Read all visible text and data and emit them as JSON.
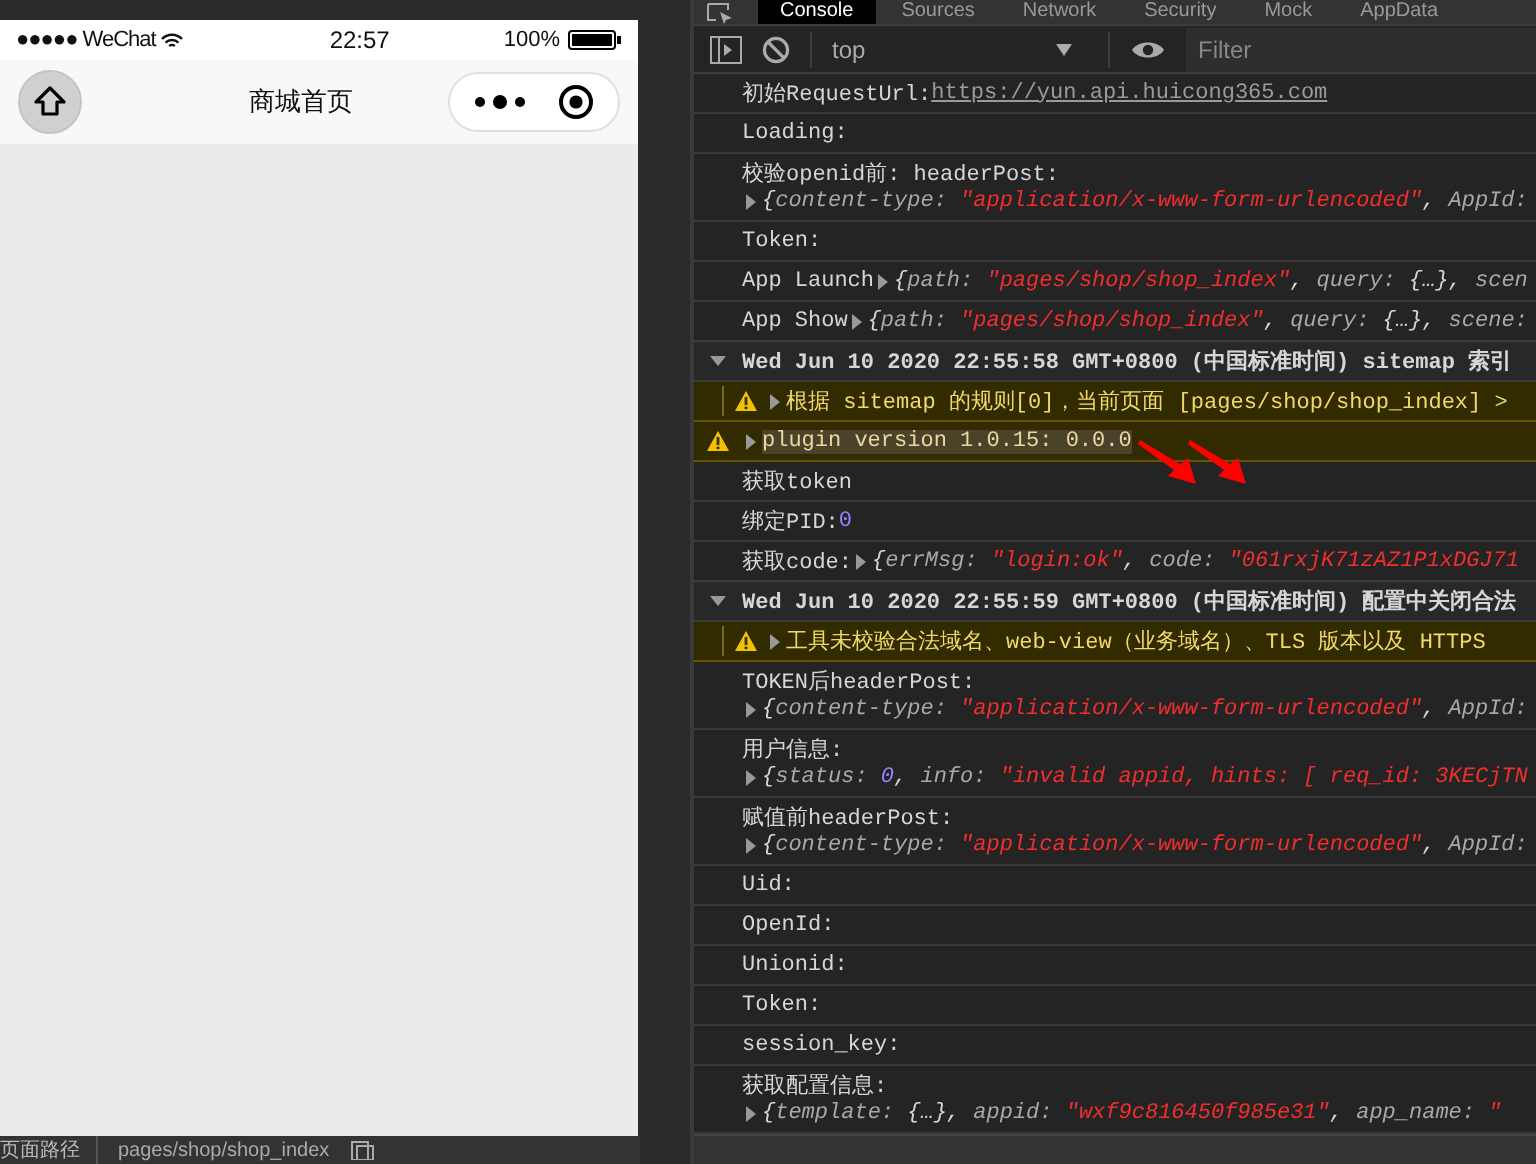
{
  "simulator": {
    "status_bar": {
      "carrier": "●●●●● WeChat",
      "time": "22:57",
      "battery": "100%"
    },
    "nav_bar": {
      "title": "商城首页"
    }
  },
  "sim_footer": {
    "label": "页面路径",
    "path": "pages/shop/shop_index"
  },
  "devtools": {
    "tabs": [
      {
        "label": "Console",
        "selected": true
      },
      {
        "label": "Sources",
        "selected": false
      },
      {
        "label": "Network",
        "selected": false
      },
      {
        "label": "Security",
        "selected": false
      },
      {
        "label": "Mock",
        "selected": false
      },
      {
        "label": "AppData",
        "selected": false
      }
    ],
    "toolbar": {
      "context": "top",
      "filter": {
        "placeholder": "Filter"
      }
    },
    "rows": [
      {
        "kind": "log",
        "text": "初始RequestUrl: ",
        "link": "https://yun.api.huicong365.com"
      },
      {
        "kind": "log",
        "text": "Loading:"
      },
      {
        "kind": "log",
        "text": "校验openid前: headerPost:",
        "object": [
          {
            "kind": "punct",
            "text": "{"
          },
          {
            "kind": "key",
            "text": "content-type: "
          },
          {
            "kind": "string",
            "text": "\"application/x-www-form-urlencoded\""
          },
          {
            "kind": "punct",
            "text": ", "
          },
          {
            "kind": "key",
            "text": "AppId:"
          }
        ]
      },
      {
        "kind": "log",
        "text": "Token:"
      },
      {
        "kind": "inline",
        "text": "App Launch ",
        "object": [
          {
            "kind": "punct",
            "text": "{"
          },
          {
            "kind": "key",
            "text": "path: "
          },
          {
            "kind": "string",
            "text": "\"pages/shop/shop_index\""
          },
          {
            "kind": "punct",
            "text": ", "
          },
          {
            "kind": "key",
            "text": "query: "
          },
          {
            "kind": "punct",
            "text": "{…}, "
          },
          {
            "kind": "key",
            "text": "scen"
          }
        ]
      },
      {
        "kind": "inline",
        "text": "App Show ",
        "object": [
          {
            "kind": "punct",
            "text": "{"
          },
          {
            "kind": "key",
            "text": "path: "
          },
          {
            "kind": "string",
            "text": "\"pages/shop/shop_index\""
          },
          {
            "kind": "punct",
            "text": ", "
          },
          {
            "kind": "key",
            "text": "query: "
          },
          {
            "kind": "punct",
            "text": "{…}, "
          },
          {
            "kind": "key",
            "text": "scene:"
          }
        ]
      },
      {
        "kind": "group",
        "text": "Wed Jun 10 2020 22:55:58 GMT+0800 (中国标准时间) sitemap 索引",
        "expanded": true
      },
      {
        "kind": "nested_warning",
        "text": "根据 sitemap 的规则[0]，当前页面 [pages/shop/shop_index] >"
      },
      {
        "kind": "warning",
        "text": "plugin version 1.0.15: 0.0.0",
        "highlighted": true
      },
      {
        "kind": "log",
        "text": "获取token"
      },
      {
        "kind": "log",
        "text": "绑定PID: ",
        "number": "0"
      },
      {
        "kind": "inline",
        "text": "获取code: ",
        "object": [
          {
            "kind": "punct",
            "text": "{"
          },
          {
            "kind": "key",
            "text": "errMsg: "
          },
          {
            "kind": "string",
            "text": "\"login:ok\""
          },
          {
            "kind": "punct",
            "text": ", "
          },
          {
            "kind": "key",
            "text": "code: "
          },
          {
            "kind": "string",
            "text": "\"061rxjK71zAZ1P1xDGJ71"
          }
        ]
      },
      {
        "kind": "group",
        "text": "Wed Jun 10 2020 22:55:59 GMT+0800 (中国标准时间) 配置中关闭合法",
        "expanded": true
      },
      {
        "kind": "nested_warning",
        "text": "工具未校验合法域名、web-view（业务域名）、TLS 版本以及 HTTPS"
      },
      {
        "kind": "log",
        "text": "TOKEN后headerPost:",
        "object": [
          {
            "kind": "punct",
            "text": "{"
          },
          {
            "kind": "key",
            "text": "content-type: "
          },
          {
            "kind": "string",
            "text": "\"application/x-www-form-urlencoded\""
          },
          {
            "kind": "punct",
            "text": ", "
          },
          {
            "kind": "key",
            "text": "AppId:"
          }
        ]
      },
      {
        "kind": "log",
        "text": "用户信息:",
        "object": [
          {
            "kind": "punct",
            "text": "{"
          },
          {
            "kind": "key",
            "text": "status: "
          },
          {
            "kind": "number",
            "text": "0"
          },
          {
            "kind": "punct",
            "text": ", "
          },
          {
            "kind": "key",
            "text": "info: "
          },
          {
            "kind": "string",
            "text": "\"invalid appid, hints: [ req_id: 3KECjTN"
          }
        ]
      },
      {
        "kind": "log",
        "text": "赋值前headerPost:",
        "object": [
          {
            "kind": "punct",
            "text": "{"
          },
          {
            "kind": "key",
            "text": "content-type: "
          },
          {
            "kind": "string",
            "text": "\"application/x-www-form-urlencoded\""
          },
          {
            "kind": "punct",
            "text": ", "
          },
          {
            "kind": "key",
            "text": "AppId:"
          }
        ]
      },
      {
        "kind": "log",
        "text": "Uid:"
      },
      {
        "kind": "log",
        "text": "OpenId:"
      },
      {
        "kind": "log",
        "text": "Unionid:"
      },
      {
        "kind": "log",
        "text": "Token:"
      },
      {
        "kind": "log",
        "text": "session_key:"
      },
      {
        "kind": "log",
        "text": "获取配置信息:",
        "object": [
          {
            "kind": "punct",
            "text": "{"
          },
          {
            "kind": "key",
            "text": "template: "
          },
          {
            "kind": "punct",
            "text": "{…}, "
          },
          {
            "kind": "key",
            "text": "appid: "
          },
          {
            "kind": "string",
            "text": "\"wxf9c816450f985e31\""
          },
          {
            "kind": "punct",
            "text": ", "
          },
          {
            "kind": "key",
            "text": "app_name: "
          },
          {
            "kind": "string",
            "text": "\""
          }
        ]
      }
    ]
  }
}
